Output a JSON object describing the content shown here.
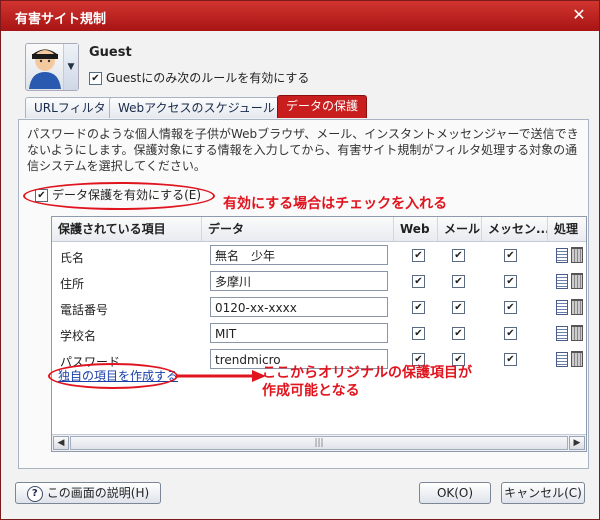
{
  "window": {
    "title": "有害サイト規制",
    "close_glyph": "✕"
  },
  "user": {
    "name": "Guest",
    "checkbox_label": "Guestにのみ次のルールを有効にする",
    "checked": true
  },
  "tabs": [
    {
      "label": "URLフィルタ",
      "active": false
    },
    {
      "label": "Webアクセスのスケジュール",
      "active": false
    },
    {
      "label": "データの保護",
      "active": true
    }
  ],
  "panel": {
    "description": "パスワードのような個人情報を子供がWebブラウザ、メール、インスタントメッセンジャーで送信できないようにします。保護対象にする情報を入力してから、有害サイト規制がフィルタ処理する対象の通信システムを選択してください。",
    "enable_label": "データ保護を有効にする(E)",
    "enable_checked": true
  },
  "annotations": {
    "enable_note": "有効にする場合はチェックを入れる",
    "add_note_line1": "ここからオリジナルの保護項目が",
    "add_note_line2": "作成可能となる"
  },
  "table": {
    "headers": {
      "item": "保護されている項目",
      "data": "データ",
      "web": "Web",
      "mail": "メール",
      "messenger": "メッセン...",
      "action": "処理"
    },
    "rows": [
      {
        "label": "氏名",
        "value": "無名　少年",
        "web": true,
        "mail": true,
        "messenger": true
      },
      {
        "label": "住所",
        "value": "多摩川",
        "web": true,
        "mail": true,
        "messenger": true
      },
      {
        "label": "電話番号",
        "value": "0120-xx-xxxx",
        "web": true,
        "mail": true,
        "messenger": true
      },
      {
        "label": "学校名",
        "value": "MIT",
        "web": true,
        "mail": true,
        "messenger": true
      },
      {
        "label": "パスワード",
        "value": "trendmicro",
        "web": true,
        "mail": true,
        "messenger": true
      }
    ],
    "add_link": "独自の項目を作成する"
  },
  "footer": {
    "help": "この画面の説明(H)",
    "ok": "OK(O)",
    "cancel": "キャンセル(C)"
  },
  "colors": {
    "accent": "#c81e1e",
    "annotation": "#e0141e",
    "link": "#1a3fa8"
  }
}
